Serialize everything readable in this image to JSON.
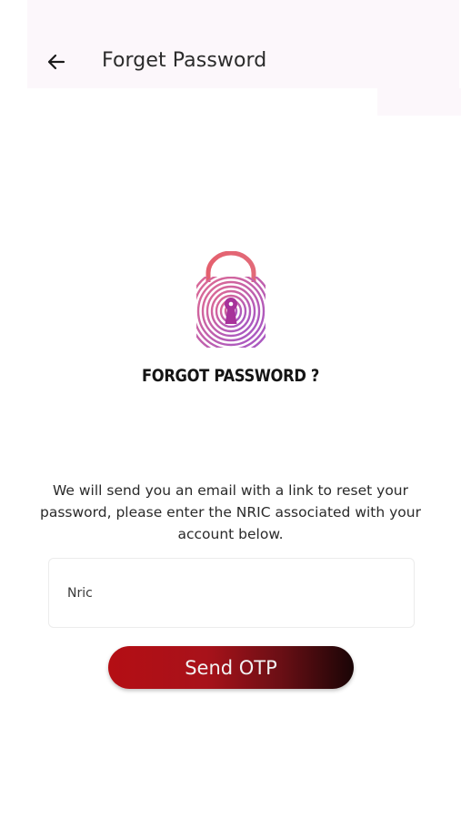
{
  "app_bar": {
    "title": "Forget Password",
    "back_icon": "arrow-left-icon"
  },
  "illustration": {
    "icon": "fingerprint-lock-icon",
    "colors": {
      "shackle": "#e4606e",
      "body_start": "#e06a90",
      "body_end": "#a256c8",
      "keyhole": "#a7329a"
    }
  },
  "heading": "FORGOT PASSWORD ?",
  "description": "We will send you an email with a link to reset your password, please enter the NRIC associated with your account below.",
  "form": {
    "nric_placeholder": "Nric",
    "nric_value": ""
  },
  "send_button": {
    "label": "Send OTP",
    "colors": {
      "gradient_start": "#b40e14",
      "gradient_end": "#1a0506"
    }
  }
}
